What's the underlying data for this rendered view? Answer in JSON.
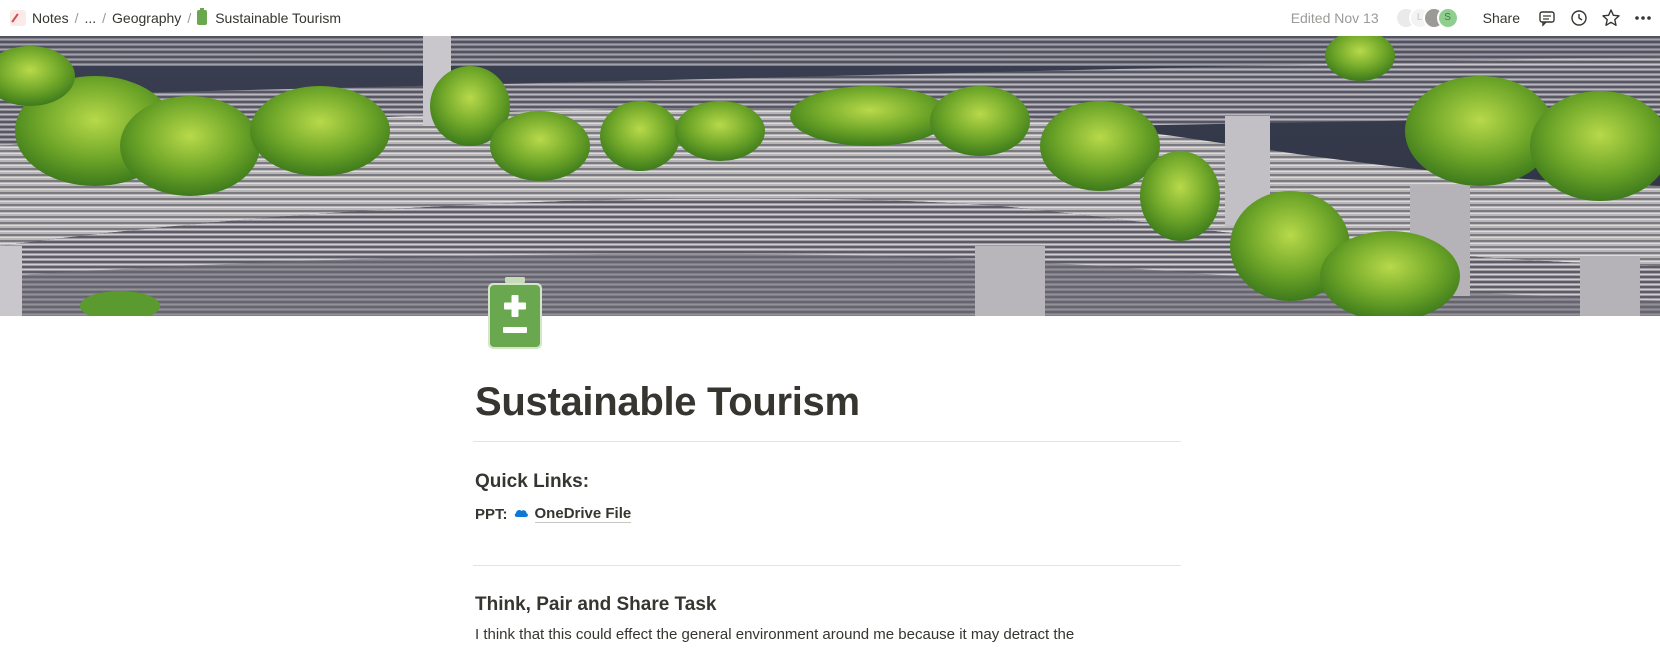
{
  "breadcrumb": {
    "items": [
      {
        "label": "Notes"
      },
      {
        "label": "..."
      },
      {
        "label": "Geography"
      },
      {
        "label": "Sustainable Tourism"
      }
    ],
    "separator": "/"
  },
  "topbar": {
    "edited": "Edited Nov 13",
    "avatars": [
      "",
      "L",
      "",
      "S"
    ],
    "share_label": "Share",
    "icons": [
      "comment-icon",
      "history-icon",
      "star-icon",
      "more-icon"
    ]
  },
  "cover": {
    "description_icon": "cover-image"
  },
  "page": {
    "icon": "battery-plus-minus-icon",
    "title": "Sustainable Tourism",
    "quick_links_heading": "Quick Links:",
    "ppt_label": "PPT:",
    "ppt_link": "OneDrive File",
    "section_heading": "Think, Pair and Share Task",
    "paragraph": "I think that this could effect the general environment around me because it may detract the"
  },
  "colors": {
    "accent_green": "#6aa84f",
    "text": "#37352f",
    "muted": "#9b9a97",
    "onedrive_blue": "#0f78d4"
  }
}
